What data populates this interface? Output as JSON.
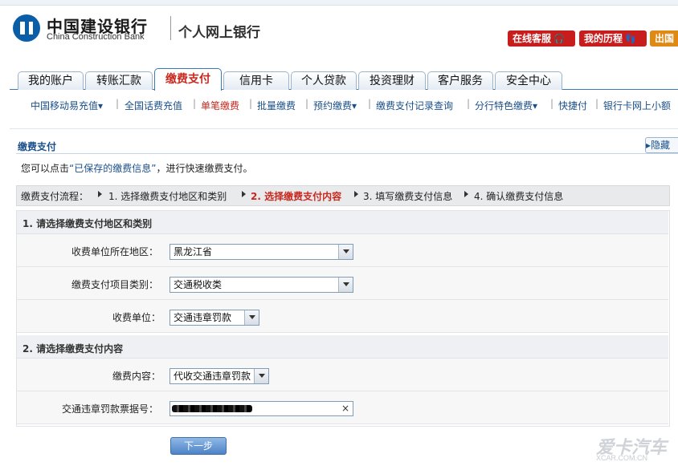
{
  "header": {
    "bank_name_cn": "中国建设银行",
    "bank_name_en": "China Construction Bank",
    "site_name": "个人网上银行",
    "buttons": [
      {
        "label": "在线客服",
        "icon": "headset-icon",
        "color": "#c81d1d"
      },
      {
        "label": "我的历程",
        "icon": "footprints-icon",
        "color": "#c81d1d"
      },
      {
        "label": "出国",
        "color": "#e08a16"
      }
    ]
  },
  "tabs": [
    {
      "label": "我的账户",
      "active": false
    },
    {
      "label": "转账汇款",
      "active": false
    },
    {
      "label": "缴费支付",
      "active": true
    },
    {
      "label": "信用卡",
      "active": false
    },
    {
      "label": "个人贷款",
      "active": false
    },
    {
      "label": "投资理财",
      "active": false
    },
    {
      "label": "客户服务",
      "active": false
    },
    {
      "label": "安全中心",
      "active": false
    }
  ],
  "subnav": [
    {
      "label": "中国移动易充值",
      "dropdown": true
    },
    {
      "label": "全国话费充值",
      "dropdown": false
    },
    {
      "label": "单笔缴费",
      "dropdown": false,
      "active": true
    },
    {
      "label": "批量缴费",
      "dropdown": false
    },
    {
      "label": "预约缴费",
      "dropdown": true
    },
    {
      "label": "缴费支付记录查询",
      "dropdown": false
    },
    {
      "label": "分行特色缴费",
      "dropdown": true
    },
    {
      "label": "快捷付",
      "dropdown": false
    },
    {
      "label": "银行卡网上小额",
      "dropdown": false
    }
  ],
  "content": {
    "section_title": "缴费支付",
    "hide_label": "隐藏",
    "tip_prefix": "您可以点击",
    "tip_link": "“已保存的缴费信息”",
    "tip_suffix": "，进行快速缴费支付。",
    "flow": {
      "label": "缴费支付流程：",
      "steps": [
        {
          "label": "1. 选择缴费支付地区和类别",
          "current": false
        },
        {
          "label": "2. 选择缴费支付内容",
          "current": true
        },
        {
          "label": "3. 填写缴费支付信息",
          "current": false
        },
        {
          "label": "4. 确认缴费支付信息",
          "current": false
        }
      ]
    },
    "section1": {
      "title": "1. 请选择缴费支付地区和类别",
      "fields": [
        {
          "label": "收费单位所在地区：",
          "value": "黑龙江省"
        },
        {
          "label": "缴费支付项目类别：",
          "value": "交通税收类"
        },
        {
          "label": "收费单位：",
          "value": "交通违章罚款"
        }
      ]
    },
    "section2": {
      "title": "2. 请选择缴费支付内容",
      "fields": [
        {
          "label": "缴费内容：",
          "value": "代收交通违章罚款"
        },
        {
          "label": "交通违章罚款票据号：",
          "value": ""
        }
      ],
      "clear_symbol": "×"
    },
    "next_button": "下一步"
  },
  "watermark": {
    "text": "爱卡汽车",
    "url": "XCAR.COM.CN"
  },
  "colors": {
    "brand_blue": "#0a5ea8",
    "active_red": "#c8281e",
    "link_blue": "#1a4f8a"
  }
}
